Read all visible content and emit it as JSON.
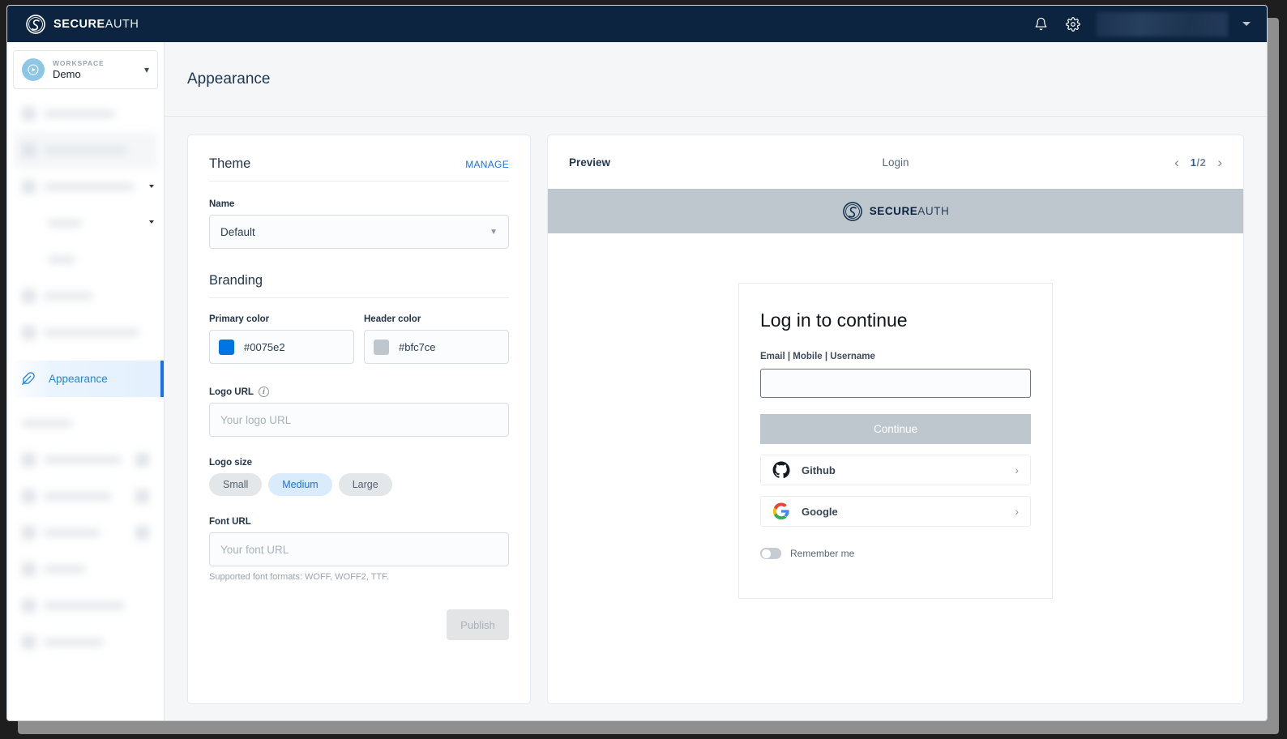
{
  "topbar": {
    "brand_bold": "SECURE",
    "brand_thin": "AUTH",
    "logo_icon": "secureauth-logo-icon",
    "bell_icon": "bell-icon",
    "gear_icon": "gear-icon",
    "user_menu_icon": "caret-down-icon"
  },
  "sidebar": {
    "workspace_kicker": "WORKSPACE",
    "workspace_name": "Demo",
    "workspace_chevron": "chevron-down-icon",
    "active_item": {
      "label": "Appearance",
      "icon": "feather-icon"
    }
  },
  "page": {
    "title": "Appearance"
  },
  "theme": {
    "section_title": "Theme",
    "manage_label": "MANAGE",
    "name_label": "Name",
    "name_value": "Default",
    "branding_title": "Branding",
    "primary_color_label": "Primary color",
    "primary_color_value": "#0075e2",
    "header_color_label": "Header color",
    "header_color_value": "#bfc7ce",
    "logo_url_label": "Logo URL",
    "logo_url_value": "",
    "logo_url_placeholder": "Your logo URL",
    "logo_size_label": "Logo size",
    "logo_sizes": [
      {
        "label": "Small",
        "selected": false
      },
      {
        "label": "Medium",
        "selected": true
      },
      {
        "label": "Large",
        "selected": false
      }
    ],
    "font_url_label": "Font URL",
    "font_url_value": "",
    "font_url_placeholder": "Your font URL",
    "font_hint": "Supported font formats: WOFF, WOFF2, TTF.",
    "publish_label": "Publish"
  },
  "preview": {
    "title": "Preview",
    "screen_name": "Login",
    "page_current": "1",
    "page_separator": "/",
    "page_total": "2",
    "prev_icon": "chevron-left-icon",
    "next_icon": "chevron-right-icon",
    "banner": {
      "brand_bold": "SECURE",
      "brand_thin": "AUTH",
      "background": "#bfc7ce"
    },
    "login": {
      "heading": "Log in to continue",
      "identifier_label": "Email | Mobile | Username",
      "identifier_value": "",
      "continue_label": "Continue",
      "providers": [
        {
          "name": "Github",
          "icon": "github-icon"
        },
        {
          "name": "Google",
          "icon": "google-icon"
        }
      ],
      "remember_label": "Remember me",
      "remember_on": false
    }
  }
}
